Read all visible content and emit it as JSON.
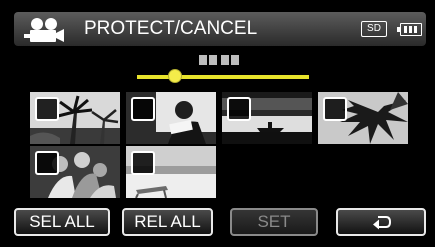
{
  "header": {
    "mode_icon": "video-camera-icon",
    "title": "PROTECT/CANCEL",
    "media_label": "SD",
    "battery_icon": "battery-icon"
  },
  "page_indicator": {
    "position": 0.22
  },
  "thumbnails": [
    {
      "scene": "palm-trees",
      "selected": false
    },
    {
      "scene": "reading-person",
      "selected": false
    },
    {
      "scene": "lake-boat",
      "selected": false
    },
    {
      "scene": "palm-leaves",
      "selected": false
    },
    {
      "scene": "family-group",
      "selected": false
    },
    {
      "scene": "beach-chair",
      "selected": false
    }
  ],
  "buttons": {
    "sel_all": "SEL ALL",
    "rel_all": "REL ALL",
    "set": "SET",
    "back_icon": "return-arrow-icon"
  }
}
